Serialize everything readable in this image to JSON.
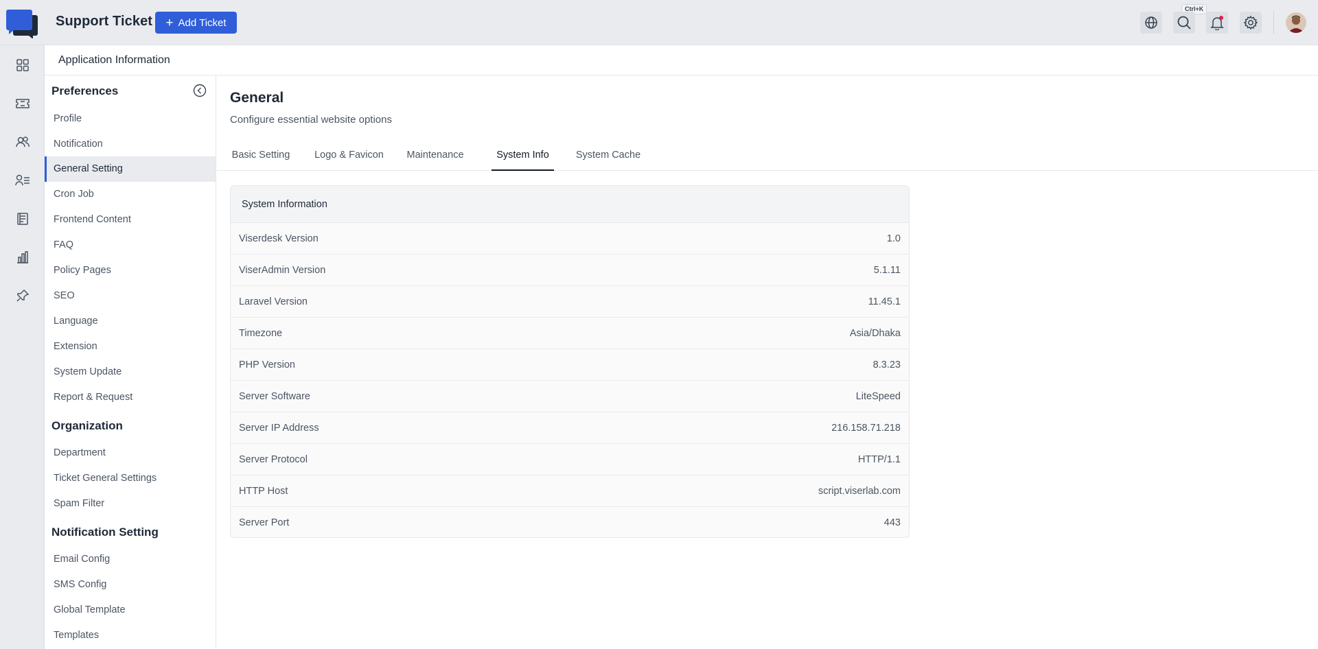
{
  "topbar": {
    "app_title": "Support Ticket",
    "add_button_label": "Add Ticket",
    "shortcut_hint": "Ctrl+K",
    "icons": [
      "globe-icon",
      "search-icon",
      "bell-icon",
      "gear-icon"
    ],
    "notification_dot_color": "#e11d48"
  },
  "rail": {
    "items": [
      "dashboard-icon",
      "ticket-icon",
      "users-icon",
      "user-list-icon",
      "article-icon",
      "chart-icon",
      "pin-icon"
    ]
  },
  "page_header": {
    "title": "Application Information"
  },
  "sidebar": {
    "sections": [
      {
        "title": "Preferences",
        "items": [
          "Profile",
          "Notification",
          "General Setting",
          "Cron Job",
          "Frontend Content",
          "FAQ",
          "Policy Pages",
          "SEO",
          "Language",
          "Extension",
          "System Update",
          "Report & Request"
        ]
      },
      {
        "title": "Organization",
        "items": [
          "Department",
          "Ticket General Settings",
          "Spam Filter"
        ]
      },
      {
        "title": "Notification Setting",
        "items": [
          "Email Config",
          "SMS Config",
          "Global Template",
          "Templates"
        ]
      }
    ],
    "active_item": "General Setting"
  },
  "main": {
    "title": "General",
    "subtitle": "Configure essential website options",
    "tabs": [
      "Basic Setting",
      "Logo & Favicon",
      "Maintenance",
      "System Info",
      "System Cache"
    ],
    "active_tab": "System Info"
  },
  "system_info": {
    "header": "System Information",
    "rows": [
      {
        "label": "Viserdesk Version",
        "value": "1.0"
      },
      {
        "label": "ViserAdmin Version",
        "value": "5.1.11"
      },
      {
        "label": "Laravel Version",
        "value": "11.45.1"
      },
      {
        "label": "Timezone",
        "value": "Asia/Dhaka"
      },
      {
        "label": "PHP Version",
        "value": "8.3.23"
      },
      {
        "label": "Server Software",
        "value": "LiteSpeed"
      },
      {
        "label": "Server IP Address",
        "value": "216.158.71.218"
      },
      {
        "label": "Server Protocol",
        "value": "HTTP/1.1"
      },
      {
        "label": "HTTP Host",
        "value": "script.viserlab.com"
      },
      {
        "label": "Server Port",
        "value": "443"
      }
    ]
  },
  "colors": {
    "accent": "#2f5ed8",
    "chrome": "#e9ebef"
  }
}
